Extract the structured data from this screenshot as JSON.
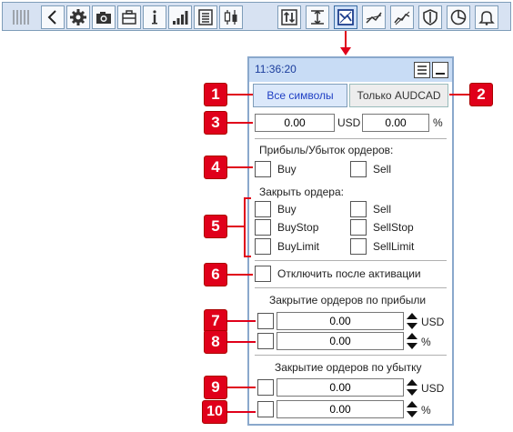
{
  "toolbar": {
    "icons": [
      "grip-icon",
      "back-icon",
      "gear-icon",
      "camera-icon",
      "briefcase-icon",
      "info-icon",
      "signal-bars-icon",
      "list-icon",
      "candlestick-icon",
      "arrows-up-down-icon",
      "level-icon",
      "chart-tool-icon",
      "trend-line-icon",
      "zigzag-icon",
      "shield-icon",
      "pie-chart-icon",
      "bell-icon"
    ]
  },
  "panel": {
    "time": "11:36:20",
    "tab_all": "Все символы",
    "tab_only": "Только AUDCAD",
    "amount_value": "0.00",
    "amount_unit": "USD",
    "percent_value": "0.00",
    "percent_unit": "%",
    "pl_title": "Прибыль/Убыток ордеров:",
    "pl_buy": "Buy",
    "pl_sell": "Sell",
    "close_title": "Закрыть ордера:",
    "close_buy": "Buy",
    "close_sell": "Sell",
    "close_buystop": "BuyStop",
    "close_sellstop": "SellStop",
    "close_buylimit": "BuyLimit",
    "close_selllimit": "SellLimit",
    "disable_label": "Отключить после активации",
    "profit_title": "Закрытие ордеров по прибыли",
    "profit_usd_value": "0.00",
    "profit_usd_unit": "USD",
    "profit_pct_value": "0.00",
    "profit_pct_unit": "%",
    "loss_title": "Закрытие ордеров по убытку",
    "loss_usd_value": "0.00",
    "loss_usd_unit": "USD",
    "loss_pct_value": "0.00",
    "loss_pct_unit": "%"
  },
  "markers": [
    "1",
    "2",
    "3",
    "4",
    "5",
    "6",
    "7",
    "8",
    "9",
    "10"
  ],
  "colors": {
    "marker": "#e0001a",
    "accent_blue": "#1f3fc4",
    "title_bar": "#c8dcf5"
  }
}
